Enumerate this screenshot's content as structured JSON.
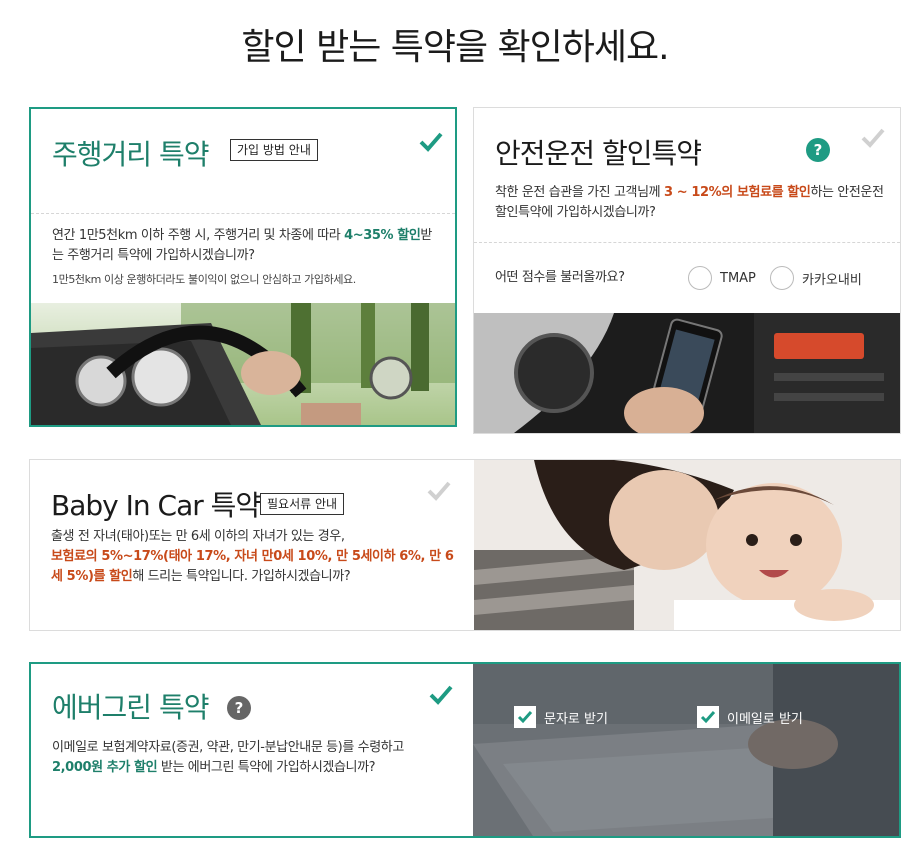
{
  "page": {
    "title": "할인 받는 특약을 확인하세요."
  },
  "mileage": {
    "title": "주행거리 특약",
    "guide_label": "가입 방법 안내",
    "desc_pre": "연간 1만5천km 이하 주행 시, 주행거리 및 차종에 따라 ",
    "desc_hl": "4~35% 할인",
    "desc_post": "받는 주행거리 특약에 가입하시겠습니까?",
    "note": "1만5천km 이상 운행하더라도 불이익이 없으니 안심하고 가입하세요.",
    "selected": true
  },
  "safe_driving": {
    "title": "안전운전 할인특약",
    "desc_pre": "착한 운전 습관을 가진 고객님께 ",
    "desc_hl": "3 ~ 12%의 보험료를 할인",
    "desc_post": "하는 안전운전 할인특약에 가입하시겠습니까?",
    "score_question": "어떤 점수를 불러올까요?",
    "options": [
      "TMAP",
      "카카오내비"
    ],
    "selected": false
  },
  "baby": {
    "title": "Baby In Car 특약",
    "guide_label": "필요서류 안내",
    "desc_pre": "출생 전 자녀(태아)또는 만 6세 이하의 자녀가 있는 경우,",
    "desc_hl": "보험료의 5%~17%(태아 17%, 자녀 만0세 10%, 만 5세이하 6%, 만 6세 5%)를 할인",
    "desc_post": "해 드리는 특약입니다. 가입하시겠습니까?",
    "selected": false
  },
  "evergreen": {
    "title": "에버그린 특약",
    "desc_pre": "이메일로 보험계약자료(증권, 약관, 만기-분납안내문 등)를 수령하고 ",
    "desc_hl": "2,000원 추가 할인",
    "desc_post": " 받는 에버그린 특약에 가입하시겠습니까?",
    "options": [
      "문자로 받기",
      "이메일로 받기"
    ],
    "selected": true
  },
  "colors": {
    "accent": "#1e9b83",
    "highlight": "#c84a1a",
    "unchecked": "#d0d0d0"
  }
}
